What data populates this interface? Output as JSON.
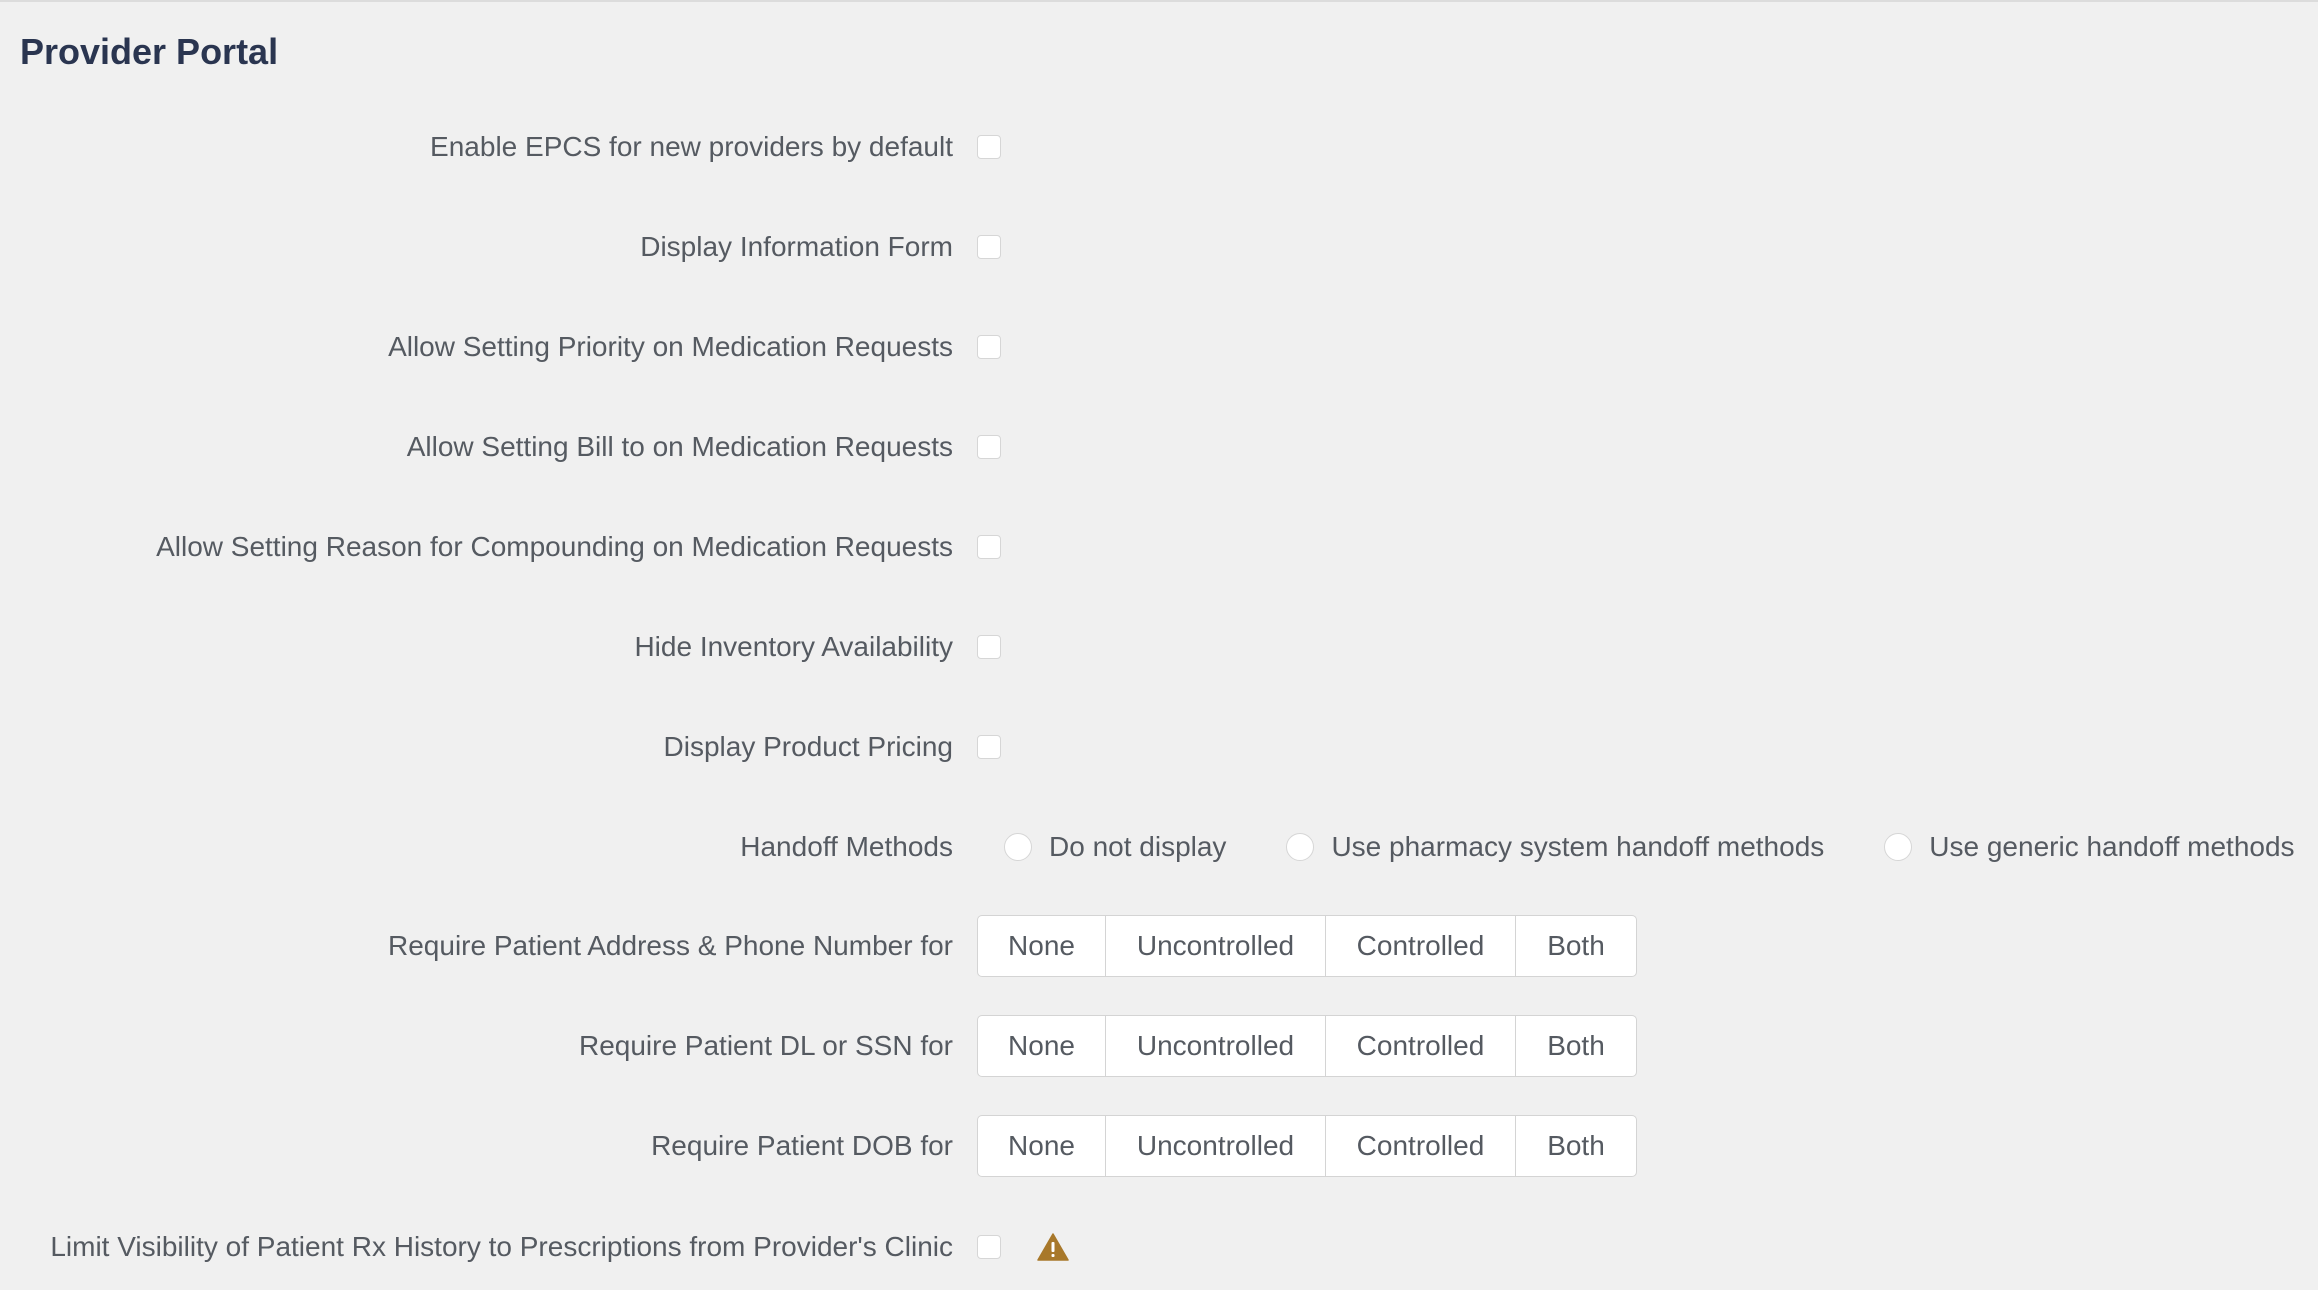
{
  "section": {
    "title": "Provider Portal"
  },
  "settings": {
    "enable_epcs": {
      "label": "Enable EPCS for new providers by default",
      "checked": false
    },
    "display_info_form": {
      "label": "Display Information Form",
      "checked": false
    },
    "allow_priority": {
      "label": "Allow Setting Priority on Medication Requests",
      "checked": false
    },
    "allow_bill_to": {
      "label": "Allow Setting Bill to on Medication Requests",
      "checked": false
    },
    "allow_reason_compounding": {
      "label": "Allow Setting Reason for Compounding on Medication Requests",
      "checked": false
    },
    "hide_inventory": {
      "label": "Hide Inventory Availability",
      "checked": false
    },
    "display_pricing": {
      "label": "Display Product Pricing",
      "checked": false
    },
    "handoff_methods": {
      "label": "Handoff Methods",
      "options": [
        "Do not display",
        "Use pharmacy system handoff methods",
        "Use generic handoff methods"
      ]
    },
    "require_address_phone": {
      "label": "Require Patient Address & Phone Number for",
      "options": [
        "None",
        "Uncontrolled",
        "Controlled",
        "Both"
      ]
    },
    "require_dl_ssn": {
      "label": "Require Patient DL or SSN for",
      "options": [
        "None",
        "Uncontrolled",
        "Controlled",
        "Both"
      ]
    },
    "require_dob": {
      "label": "Require Patient DOB for",
      "options": [
        "None",
        "Uncontrolled",
        "Controlled",
        "Both"
      ]
    },
    "limit_rx_history": {
      "label": "Limit Visibility of Patient Rx History to Prescriptions from Provider's Clinic",
      "checked": false,
      "icon": "warning-icon"
    }
  },
  "colors": {
    "background": "#f0f0f0",
    "title": "#2a3550",
    "label": "#555a61",
    "warning": "#a8782a"
  }
}
